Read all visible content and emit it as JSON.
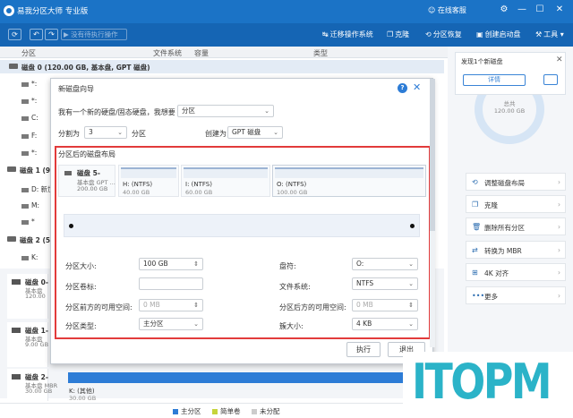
{
  "app": {
    "title": "易我分区大师 专业版",
    "user": "在线客服",
    "window_buttons": [
      "⚙",
      "—",
      "☐",
      "✕"
    ]
  },
  "toolbar": {
    "undo": "↶",
    "redo": "↷",
    "pending": "▶ 没有待执行操作",
    "items": [
      {
        "label": "迁移操作系统",
        "icon": "↹"
      },
      {
        "label": "克隆",
        "icon": "❐"
      },
      {
        "label": "分区恢复",
        "icon": "⟲"
      },
      {
        "label": "创建启动盘",
        "icon": "▣"
      },
      {
        "label": "工具",
        "icon": "⚒"
      }
    ]
  },
  "table_header": {
    "partition": "分区",
    "fs": "文件系统",
    "capacity": "容量",
    "type": "类型"
  },
  "tree": {
    "disk0": "磁盘 0 (120.00 GB, 基本盘, GPT 磁盘)",
    "disk0_parts": [
      "*:",
      "*:",
      "C:",
      "F:",
      "*:"
    ],
    "disk1": "磁盘 1 (9",
    "disk1_parts": [
      "D: 新加",
      "M:",
      "*"
    ],
    "disk2": "磁盘 2 (5",
    "disk2_parts": [
      "K:"
    ]
  },
  "disk_cards": [
    {
      "name": "磁盘 0-",
      "type": "基本盘",
      "size": "120.00"
    },
    {
      "name": "磁盘 1-",
      "type": "基本盘",
      "size": "9.00 GB"
    },
    {
      "name": "磁盘 2-",
      "type": "基本盘 MBR",
      "size": "30.00 GB"
    }
  ],
  "bottom_disk": {
    "part_label": "K: (其他)",
    "part_size": "30.00 GB"
  },
  "legend": [
    {
      "label": "主分区",
      "color": "#2d7cd6"
    },
    {
      "label": "简单卷",
      "color": "#c6d43b"
    },
    {
      "label": "未分配",
      "color": "#cccccc"
    }
  ],
  "right": {
    "notice": "发现1个新磁盘",
    "notice_close": "✕",
    "details": "详情",
    "donut_total": "总共",
    "donut_size": "120.00 GB",
    "actions": [
      {
        "label": "调整磁盘布局",
        "icon": "⟲"
      },
      {
        "label": "克隆",
        "icon": "❐"
      },
      {
        "label": "删除所有分区",
        "icon": "🗑"
      },
      {
        "label": "转换为 MBR",
        "icon": "⇄"
      },
      {
        "label": "4K 对齐",
        "icon": "⊞"
      },
      {
        "label": "更多",
        "icon": "•••"
      }
    ],
    "arrow": "›"
  },
  "dialog": {
    "title": "新磁盘向导",
    "help": "?",
    "close": "✕",
    "question": "我有一个新的硬盘/固态硬盘，我想要",
    "action": "分区",
    "split_into": "分割为",
    "split_count": "3",
    "split_unit": "分区",
    "create_as": "创建为",
    "disk_type": "GPT 磁盘",
    "layout_title": "分区后的磁盘布局",
    "layout_disk": {
      "name": "磁盘 5-",
      "type": "基本盘 GPT ...",
      "size": "200.00 GB"
    },
    "layout_parts": [
      {
        "name": "H: (NTFS)",
        "size": "40.00 GB"
      },
      {
        "name": "I: (NTFS)",
        "size": "60.00 GB"
      },
      {
        "name": "O: (NTFS)",
        "size": "100.00 GB"
      }
    ],
    "form": {
      "size_label": "分区大小:",
      "size_value": "100 GB",
      "label_label": "分区卷标:",
      "label_value": "",
      "before_label": "分区前方的可用空间:",
      "before_value": "0 MB",
      "type_label": "分区类型:",
      "type_value": "主分区",
      "letter_label": "盘符:",
      "letter_value": "O:",
      "fs_label": "文件系统:",
      "fs_value": "NTFS",
      "after_label": "分区后方的可用空间:",
      "after_value": "0 MB",
      "cluster_label": "簇大小:",
      "cluster_value": "4 KB"
    },
    "execute": "执行",
    "exit": "退出"
  },
  "watermark": "ITOPM"
}
